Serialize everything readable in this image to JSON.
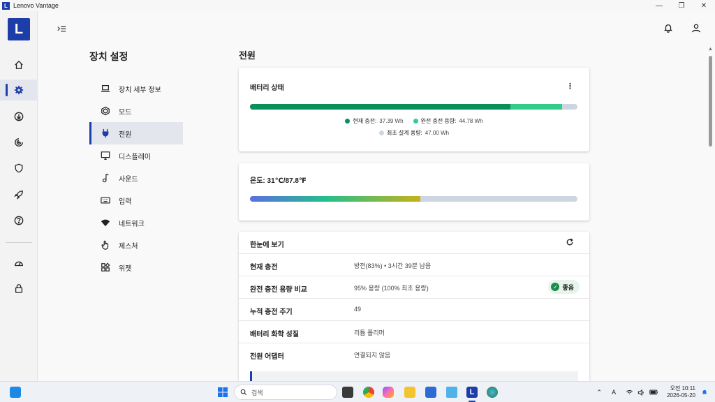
{
  "window": {
    "title": "Lenovo Vantage",
    "logo_letter": "L",
    "ctrl_min": "—",
    "ctrl_max": "❐",
    "ctrl_close": "✕"
  },
  "colors": {
    "brand": "#1d3ea8",
    "battery_current": "#0a8f5a",
    "battery_full": "#33cc8a",
    "battery_design": "#cdd5e0",
    "good": "#1e8a4c"
  },
  "rail": {
    "icons": [
      "home-icon",
      "gear-icon",
      "download-icon",
      "radar-icon",
      "shield-icon",
      "rocket-icon",
      "help-icon",
      "gauge-icon",
      "lock-icon"
    ],
    "active": "gear-icon"
  },
  "settings": {
    "title": "장치 설정",
    "nav": [
      {
        "label": "장치 세부 정보",
        "icon": "laptop-icon"
      },
      {
        "label": "모드",
        "icon": "hexagon-icon"
      },
      {
        "label": "전원",
        "icon": "plug-icon",
        "active": true
      },
      {
        "label": "디스플레이",
        "icon": "monitor-icon"
      },
      {
        "label": "사운드",
        "icon": "music-note-icon"
      },
      {
        "label": "입력",
        "icon": "keyboard-icon"
      },
      {
        "label": "네트워크",
        "icon": "wifi-icon"
      },
      {
        "label": "제스처",
        "icon": "hand-icon"
      },
      {
        "label": "위젯",
        "icon": "widgets-icon"
      }
    ]
  },
  "power": {
    "section_title": "전원",
    "battery": {
      "title": "배터리 상태",
      "menu": "⋮",
      "current_label": "현재 충전:",
      "current_value": "37.39 Wh",
      "current": 37.39,
      "full_label": "완전 충전 용량:",
      "full_value": "44.78 Wh",
      "full": 44.78,
      "design_label": "최초 설계 용량:",
      "design_value": "47.00 Wh",
      "design": 47.0
    },
    "temperature": {
      "label": "온도:",
      "value": "31℃/87.8℉",
      "level": 0.52
    },
    "glance": {
      "title": "한눈에 보기",
      "rows": [
        {
          "key": "현재 충전",
          "value": "방전(83%)  •  3시간 39분 남음"
        },
        {
          "key": "완전 충전 용량 비교",
          "value": "95% 용량 (100% 최초 용량)",
          "badge": "좋음"
        },
        {
          "key": "누적 충전 주기",
          "value": "49"
        },
        {
          "key": "배터리 화학 성질",
          "value": "리튬 폴리머"
        },
        {
          "key": "전원 어댑터",
          "value": "연결되지 않음"
        }
      ]
    }
  },
  "taskbar": {
    "search_placeholder": "검색",
    "clock_time": "오전 10:11",
    "clock_date": "2026-05-20",
    "ime": "A"
  }
}
